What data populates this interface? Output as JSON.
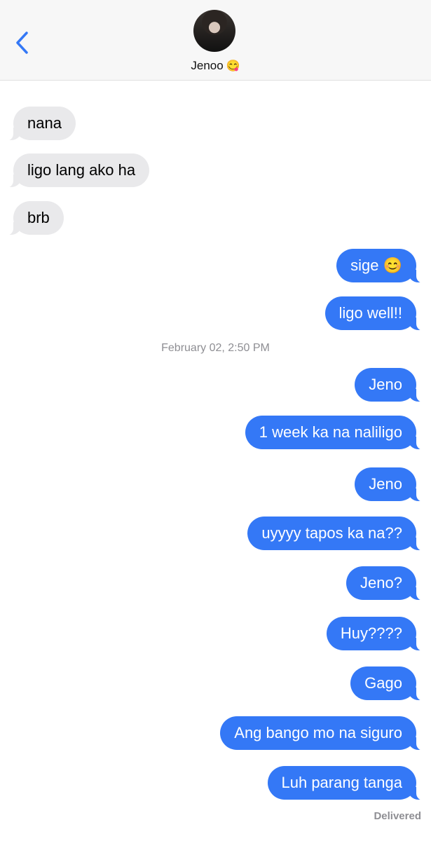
{
  "header": {
    "contact_name": "Jenoo",
    "contact_emoji": "😋",
    "back_icon": "chevron-left-icon",
    "accent_color": "#3478f6"
  },
  "messages": [
    {
      "direction": "incoming",
      "text": "nana"
    },
    {
      "direction": "incoming",
      "text": "ligo lang ako ha"
    },
    {
      "direction": "incoming",
      "text": "brb"
    },
    {
      "direction": "outgoing",
      "text": "sige 😊"
    },
    {
      "direction": "outgoing",
      "text": "ligo well!!"
    },
    {
      "direction": "outgoing",
      "text": "Jeno"
    },
    {
      "direction": "outgoing",
      "text": "1 week ka na naliligo"
    },
    {
      "direction": "outgoing",
      "text": "Jeno"
    },
    {
      "direction": "outgoing",
      "text": "uyyyy tapos ka na??"
    },
    {
      "direction": "outgoing",
      "text": "Jeno?"
    },
    {
      "direction": "outgoing",
      "text": "Huy????"
    },
    {
      "direction": "outgoing",
      "text": "Gago"
    },
    {
      "direction": "outgoing",
      "text": "Ang bango mo na siguro"
    },
    {
      "direction": "outgoing",
      "text": "Luh parang tanga"
    }
  ],
  "timestamp": "February 02, 2:50 PM",
  "status": "Delivered"
}
